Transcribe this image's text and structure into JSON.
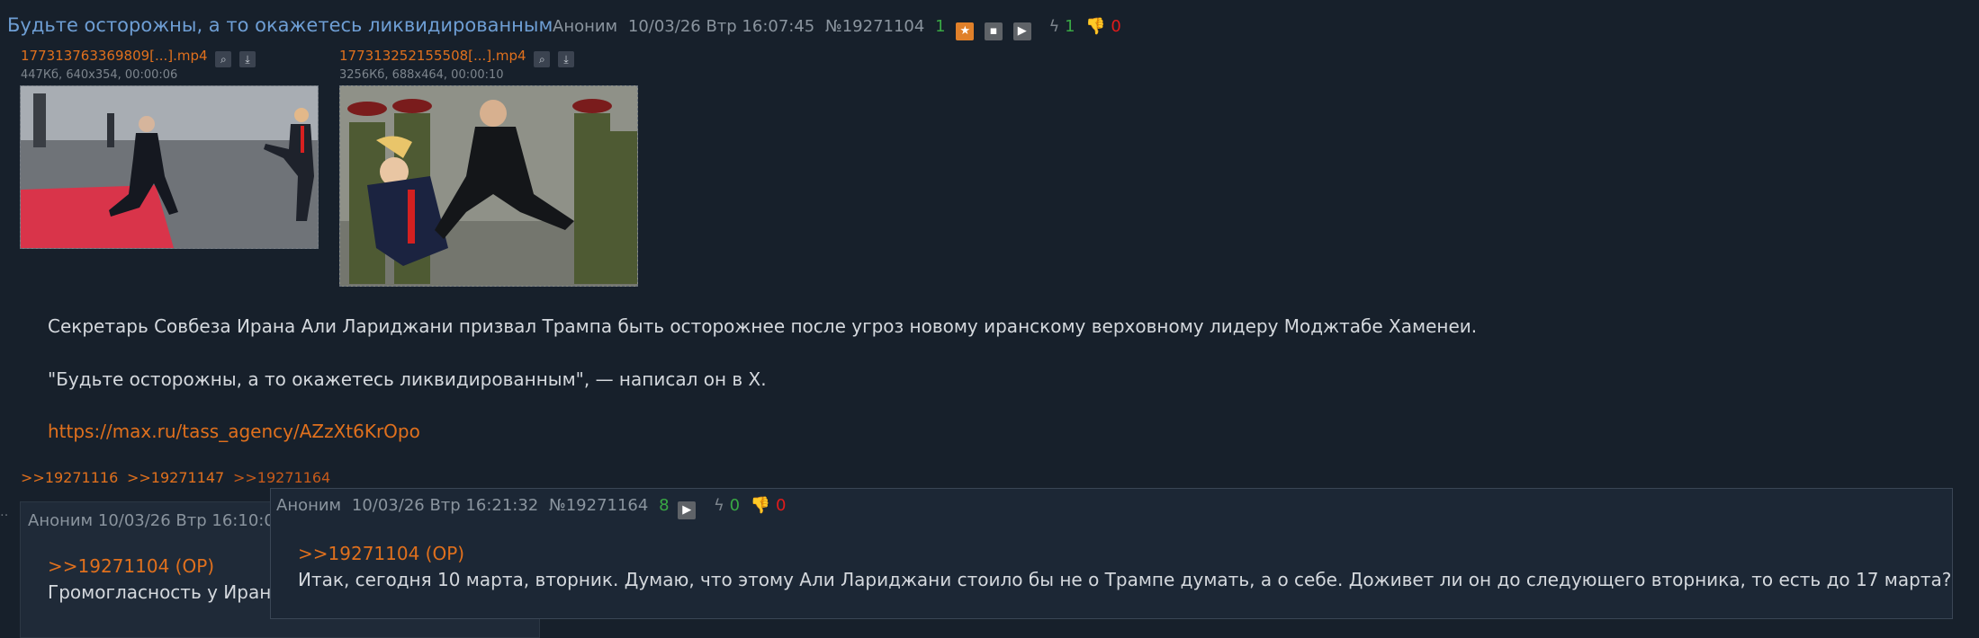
{
  "op": {
    "title": "Будьте осторожны, а то окажетесь ликвидированным",
    "author": "Аноним",
    "datetime": "10/03/26 Втр 16:07:45",
    "number": "№19271104",
    "counter": "1",
    "likes": "1",
    "dislikes": "0",
    "files": [
      {
        "name": "17731376336980​9[...].mp4",
        "info": "447Кб, 640x354, 00:00:06"
      },
      {
        "name": "17731325215550​8[...].mp4",
        "info": "3256Кб, 688x464, 00:00:10"
      }
    ],
    "body": [
      "Секретарь Совбеза Ирана Али Лариджани призвал Трампа быть осторожнее после угроз новому иранскому верховному лидеру Моджтабе Хаменеи.",
      "\"Будьте осторожны, а то окажетесь ликвидированным\", — написал он в X."
    ],
    "link": "https://max.ru/tass_agency/AZzXt6KrOpo",
    "replies": [
      ">>19271116",
      ">>19271147",
      ">>19271164"
    ]
  },
  "back_post": {
    "header": "Аноним 10/03/26 Втр 16:10:0",
    "quote": ">>19271104 (OP)",
    "text": "Громогласность у Ирана"
  },
  "popup": {
    "author": "Аноним",
    "datetime": "10/03/26 Втр 16:21:32",
    "number": "№19271164",
    "counter": "8",
    "likes": "0",
    "dislikes": "0",
    "quote": ">>19271104 (OP)",
    "text": "Итак, сегодня 10 марта, вторник. Думаю, что этому Али Лариджани стоило бы не о Трампе думать, а о себе. Доживет ли он до следующего вторника, то есть до 17 марта?"
  },
  "icons": {
    "star": "star-icon",
    "tile": "tile-icon",
    "play": "play-icon",
    "like": "lightning-icon",
    "dislike": "thumbs-down-icon",
    "search": "search-icon",
    "download": "download-icon"
  }
}
